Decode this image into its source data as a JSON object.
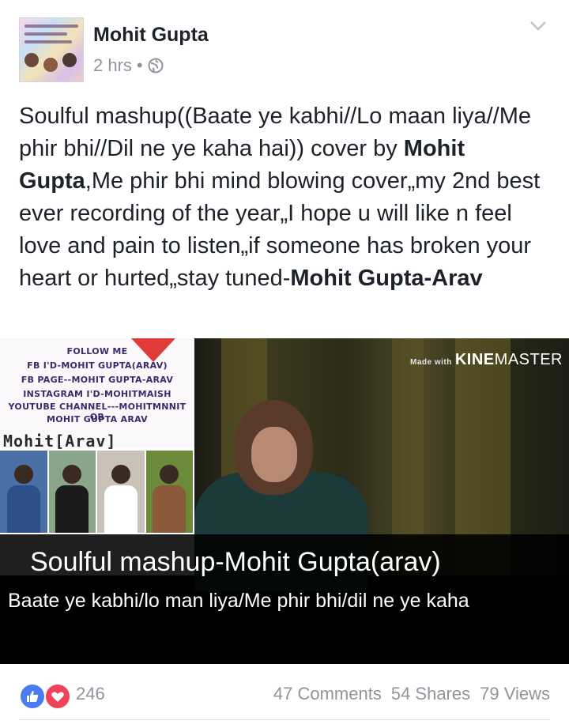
{
  "post": {
    "author": "Mohit Gupta",
    "time": "2 hrs",
    "separator": "•",
    "text_part1": "Soulful mashup((Baate ye kabhi//Lo maan liya//Me phir bhi//Dil ne ye kaha hai)) cover by ",
    "text_bold1": "Mohit Gupta",
    "text_part2": ",Me phir bhi mind blowing cover„my 2nd best ever recording of the year„I hope u will like n feel love and pain to listen„if someone has broken your heart or hurted„stay tuned-",
    "text_bold2": "Mohit Gupta-Arav"
  },
  "video": {
    "follow_lines": [
      "FOLLOW ME",
      "FB I'D-MOHIT GUPTA(ARAV)",
      "FB PAGE--MOHIT GUPTA-ARAV",
      "INSTAGRAM I'D-MOHITMAISH",
      "YOUTUBE CHANNEL---MOHITMNNIT OR",
      "MOHIT GUPTA ARAV"
    ],
    "arav_label": "Mohit[Arav]",
    "watermark_small": "Made with",
    "watermark_kine": "KINE",
    "watermark_master": "MASTER",
    "caption_title": "Soulful mashup-Mohit Gupta(arav)",
    "caption_sub": "Baate ye kabhi/lo man liya/Me phir bhi/dil ne ye kaha"
  },
  "footer": {
    "reaction_count": "246",
    "comments": "47 Comments",
    "shares": "54 Shares",
    "views": "79 Views"
  },
  "colors": {
    "like": "#4a7bf0",
    "love": "#f0435b",
    "meta": "#90949c"
  }
}
